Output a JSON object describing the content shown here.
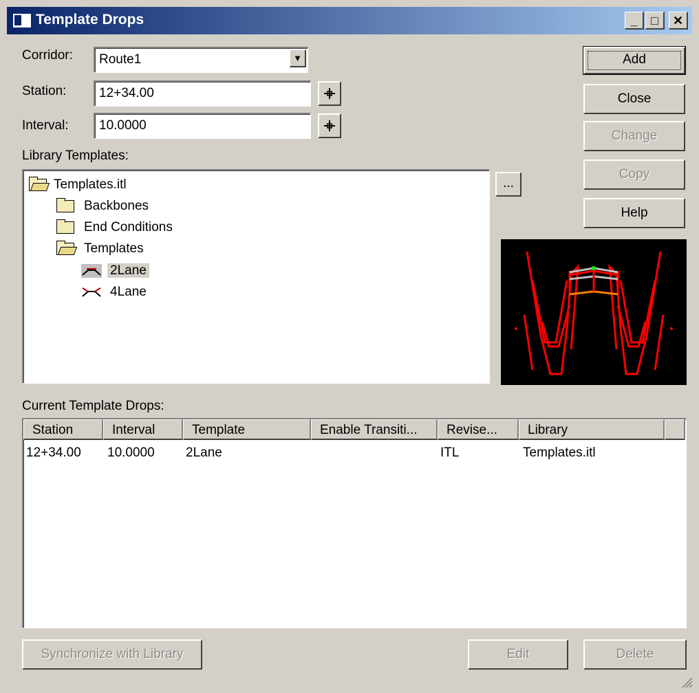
{
  "window": {
    "title": "Template Drops",
    "min_icon": "minimize-icon",
    "max_icon": "maximize-icon",
    "close_icon": "close-icon"
  },
  "corridor": {
    "label": "Corridor:",
    "value": "Route1"
  },
  "station": {
    "label": "Station:",
    "value": "12+34.00"
  },
  "interval": {
    "label": "Interval:",
    "value": "10.0000"
  },
  "library": {
    "label": "Library Templates:",
    "browse": "..."
  },
  "tree": {
    "root": "Templates.itl",
    "items": [
      "Backbones",
      "End Conditions",
      "Templates"
    ],
    "templates": [
      "2Lane",
      "4Lane"
    ]
  },
  "buttons": {
    "add": "Add",
    "close": "Close",
    "change": "Change",
    "copy": "Copy",
    "help": "Help",
    "sync": "Synchronize with Library",
    "edit": "Edit",
    "delete": "Delete"
  },
  "drops": {
    "label": "Current Template Drops:",
    "columns": [
      "Station",
      "Interval",
      "Template",
      "Enable Transiti...",
      "Revise...",
      "Library"
    ],
    "rows": [
      [
        "12+34.00",
        "10.0000",
        "2Lane",
        "",
        "ITL",
        "Templates.itl"
      ]
    ]
  },
  "colors": {
    "title_start": "#0a246a",
    "title_end": "#a6caf0",
    "preview_bg": "#000000",
    "preview_line": "#ff0000"
  }
}
